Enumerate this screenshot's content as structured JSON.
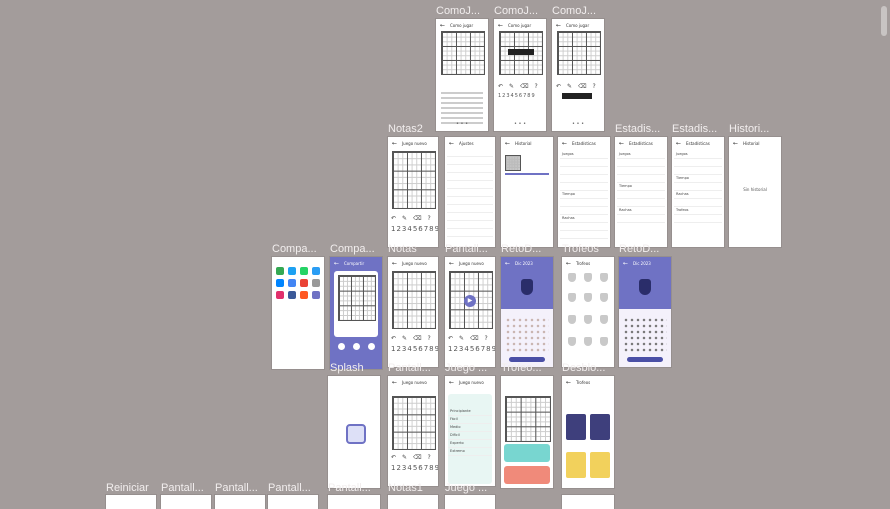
{
  "canvas": {
    "background": "#a39c9b",
    "accent": "#6f72c4"
  },
  "labels": {
    "comojugar1": "ComoJ...",
    "comojugar2": "ComoJ...",
    "comojugar3": "ComoJ...",
    "notas2": "Notas2",
    "estadis1": "Estadis...",
    "estadis2": "Estadis...",
    "histori": "Histori...",
    "compa1": "Compa...",
    "compa2": "Compa...",
    "notas": "Notas",
    "pantall_a": "Pantall...",
    "retos1": "RetoD...",
    "trofeos": "Trofeos",
    "retos2": "RetoD...",
    "splash": "Splash",
    "pantall_b": "Pantall...",
    "juego": "Juego ...",
    "trofeo2": "Trofeo...",
    "desblo": "Desblo...",
    "reiniciar": "Reiniciar",
    "pantall_c": "Pantall...",
    "pantall_d": "Pantall...",
    "pantall_e": "Pantall...",
    "pantall_f": "Pantall...",
    "notas3": "Notas1",
    "juego2": "Juego ..."
  },
  "screens": {
    "como_title": "Como jugar",
    "game_title": "Juego nuevo",
    "ajustes_title": "Ajustes",
    "historial_title": "Historial",
    "estadisticas_title": "Estadísticas",
    "compartir_title": "Compartir",
    "trofeos_title": "Trofeos",
    "reto_title": "Dic 2023",
    "splash_icon": "sudoku-logo",
    "digits": "123456789",
    "historial_empty": "Sin historial",
    "juego_nuevo_menu": [
      "Principiante",
      "Fácil",
      "Medio",
      "Difícil",
      "Experto",
      "Extremo"
    ],
    "stat_sections": [
      "Juegos",
      "Tiempo",
      "Rachas",
      "Trofeos"
    ],
    "desbloquear_title": "Trofeos"
  }
}
